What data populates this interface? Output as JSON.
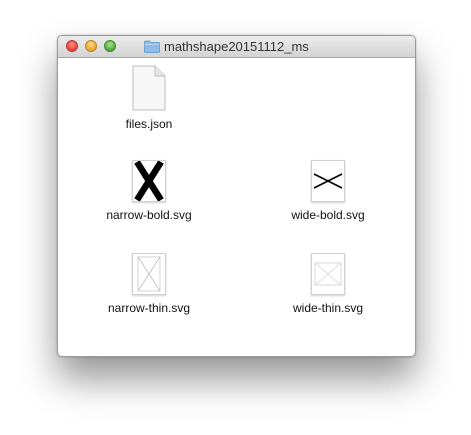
{
  "window": {
    "title": "mathshape20151112_ms"
  },
  "files": [
    {
      "label": "files.json",
      "icon": "document-icon"
    },
    {
      "label": "narrow-bold.svg",
      "icon": "svg-thumbnail-icon"
    },
    {
      "label": "wide-bold.svg",
      "icon": "svg-thumbnail-icon"
    },
    {
      "label": "narrow-thin.svg",
      "icon": "svg-thumbnail-icon"
    },
    {
      "label": "wide-thin.svg",
      "icon": "svg-thumbnail-icon"
    }
  ],
  "colors": {
    "title_text": "#333333",
    "close": "#e0443a",
    "minimize": "#e7a42c",
    "zoom": "#4fa93a",
    "folder": "#7fb3e6"
  }
}
